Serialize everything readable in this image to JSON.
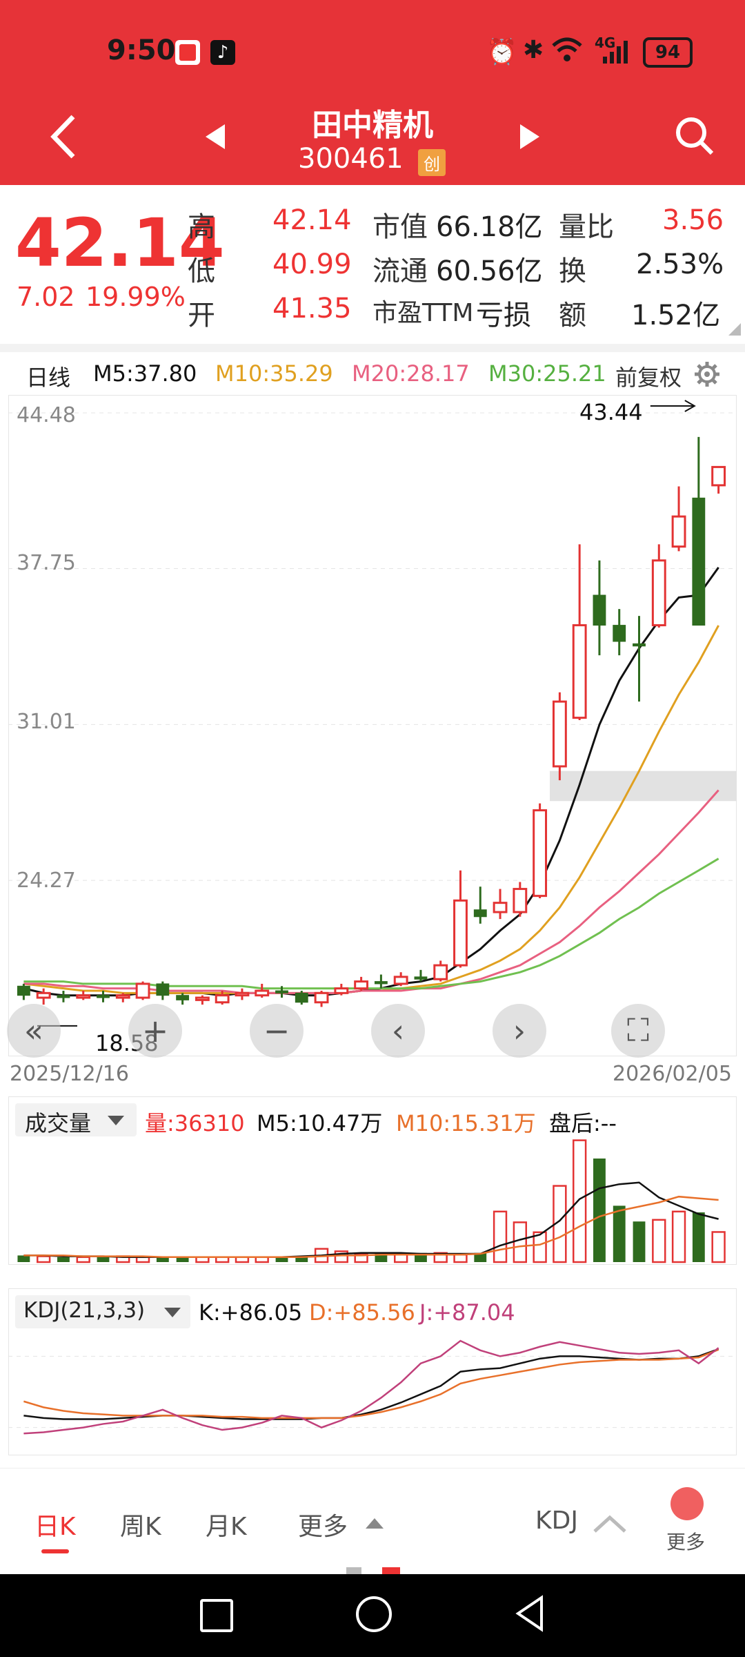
{
  "status_bar": {
    "time": "9:50",
    "battery": "94",
    "network": "4G"
  },
  "header": {
    "title": "田中精机",
    "code": "300461",
    "board_badge": "创"
  },
  "quote": {
    "price": "42.14",
    "change": "7.02",
    "change_pct": "19.99%",
    "rows": [
      {
        "l1": "高",
        "v1": "42.14",
        "l2": "市值",
        "v2": "66.18亿",
        "l3": "量比",
        "v3": "3.56"
      },
      {
        "l1": "低",
        "v1": "40.99",
        "l2": "流通",
        "v2": "60.56亿",
        "l3": "换",
        "v3": "2.53%"
      },
      {
        "l1": "开",
        "v1": "41.35",
        "l2": "市盈TTM",
        "v2": "亏损",
        "l3": "额",
        "v3": "1.52亿"
      }
    ]
  },
  "ma_bar": {
    "period": "日线",
    "m5": "M5:37.80",
    "m10": "M10:35.29",
    "m20": "M20:28.17",
    "m30": "M30:25.21",
    "adjust": "前复权"
  },
  "price_axis": [
    "44.48",
    "37.75",
    "31.01",
    "24.27"
  ],
  "price_annotations": {
    "high": "43.44",
    "low": "18.58"
  },
  "dates": {
    "start": "2025/12/16",
    "end": "2026/02/05"
  },
  "volume_bar": {
    "selector": "成交量",
    "vol": "量:36310",
    "m5": "M5:10.47万",
    "m10": "M10:15.31万",
    "after_hours": "盘后:--"
  },
  "kdj_bar": {
    "selector": "KDJ(21,3,3)",
    "k": "K:+86.05",
    "d": "D:+85.56",
    "j": "J:+87.04"
  },
  "bottom_tabs": {
    "daily": "日K",
    "weekly": "周K",
    "monthly": "月K",
    "more": "更多",
    "indicator": "KDJ",
    "more2": "更多"
  },
  "colors": {
    "header": "#e63338",
    "up": "#e33333",
    "down": "#2e6b1e",
    "m5": "#111111",
    "m10": "#e0a020",
    "m20": "#e86080",
    "m30": "#70c050"
  },
  "chart_data": {
    "type": "candlestick",
    "y_axis_ticks": [
      44.48,
      37.75,
      31.01,
      24.27
    ],
    "ylim": [
      17.5,
      44.48
    ],
    "x_range": [
      "2025/12/16",
      "2026/02/05"
    ],
    "candles": [
      {
        "o": 19.7,
        "c": 19.3,
        "h": 19.8,
        "l": 19.1
      },
      {
        "o": 19.2,
        "c": 19.4,
        "h": 19.6,
        "l": 18.9
      },
      {
        "o": 19.3,
        "c": 19.2,
        "h": 19.5,
        "l": 19.0
      },
      {
        "o": 19.2,
        "c": 19.3,
        "h": 19.5,
        "l": 19.1
      },
      {
        "o": 19.3,
        "c": 19.2,
        "h": 19.5,
        "l": 19.0
      },
      {
        "o": 19.2,
        "c": 19.3,
        "h": 19.4,
        "l": 19.0
      },
      {
        "o": 19.2,
        "c": 19.8,
        "h": 19.9,
        "l": 19.1
      },
      {
        "o": 19.8,
        "c": 19.3,
        "h": 19.9,
        "l": 19.1
      },
      {
        "o": 19.3,
        "c": 19.1,
        "h": 19.4,
        "l": 18.9
      },
      {
        "o": 19.1,
        "c": 19.2,
        "h": 19.3,
        "l": 18.9
      },
      {
        "o": 19.0,
        "c": 19.3,
        "h": 19.5,
        "l": 18.9
      },
      {
        "o": 19.3,
        "c": 19.4,
        "h": 19.6,
        "l": 19.1
      },
      {
        "o": 19.3,
        "c": 19.5,
        "h": 19.8,
        "l": 19.2
      },
      {
        "o": 19.5,
        "c": 19.4,
        "h": 19.7,
        "l": 19.2
      },
      {
        "o": 19.4,
        "c": 19.0,
        "h": 19.5,
        "l": 18.9
      },
      {
        "o": 19.0,
        "c": 19.4,
        "h": 19.5,
        "l": 18.8
      },
      {
        "o": 19.4,
        "c": 19.6,
        "h": 19.8,
        "l": 19.3
      },
      {
        "o": 19.6,
        "c": 19.9,
        "h": 20.1,
        "l": 19.5
      },
      {
        "o": 19.9,
        "c": 19.8,
        "h": 20.2,
        "l": 19.6
      },
      {
        "o": 19.8,
        "c": 20.1,
        "h": 20.3,
        "l": 19.7
      },
      {
        "o": 20.1,
        "c": 20.0,
        "h": 20.4,
        "l": 19.9
      },
      {
        "o": 20.0,
        "c": 20.6,
        "h": 20.8,
        "l": 19.9
      },
      {
        "o": 20.6,
        "c": 23.4,
        "h": 24.7,
        "l": 20.5
      },
      {
        "o": 23.0,
        "c": 22.7,
        "h": 24.0,
        "l": 22.4
      },
      {
        "o": 22.9,
        "c": 23.3,
        "h": 23.9,
        "l": 22.6
      },
      {
        "o": 22.9,
        "c": 23.9,
        "h": 24.2,
        "l": 22.7
      },
      {
        "o": 23.6,
        "c": 27.3,
        "h": 27.6,
        "l": 23.5
      },
      {
        "o": 29.2,
        "c": 32.0,
        "h": 32.4,
        "l": 28.6
      },
      {
        "o": 31.3,
        "c": 35.3,
        "h": 38.8,
        "l": 31.2
      },
      {
        "o": 36.6,
        "c": 35.3,
        "h": 38.1,
        "l": 34.0
      },
      {
        "o": 35.3,
        "c": 34.6,
        "h": 36.0,
        "l": 34.0
      },
      {
        "o": 34.5,
        "c": 34.4,
        "h": 35.7,
        "l": 32.0
      },
      {
        "o": 35.3,
        "c": 38.1,
        "h": 38.8,
        "l": 35.2
      },
      {
        "o": 38.7,
        "c": 40.0,
        "h": 41.3,
        "l": 38.5
      },
      {
        "o": 40.8,
        "c": 35.3,
        "h": 43.44,
        "l": 35.3
      },
      {
        "o": 41.35,
        "c": 42.14,
        "h": 42.14,
        "l": 40.99
      }
    ],
    "ma": {
      "M5": [
        19.6,
        19.4,
        19.3,
        19.3,
        19.3,
        19.3,
        19.4,
        19.4,
        19.4,
        19.4,
        19.3,
        19.4,
        19.4,
        19.4,
        19.3,
        19.3,
        19.4,
        19.5,
        19.6,
        19.8,
        19.9,
        20.1,
        20.7,
        21.3,
        22.1,
        22.8,
        24.1,
        26.0,
        28.4,
        31.0,
        32.9,
        34.3,
        35.5,
        36.5,
        36.6,
        37.8
      ],
      "M10": [
        19.8,
        19.7,
        19.6,
        19.5,
        19.5,
        19.4,
        19.4,
        19.4,
        19.4,
        19.4,
        19.4,
        19.4,
        19.4,
        19.4,
        19.4,
        19.4,
        19.4,
        19.5,
        19.5,
        19.6,
        19.7,
        19.8,
        20.1,
        20.4,
        20.8,
        21.3,
        22.1,
        23.1,
        24.4,
        25.9,
        27.4,
        29.0,
        30.7,
        32.3,
        33.7,
        35.29
      ],
      "M20": [
        19.8,
        19.8,
        19.7,
        19.7,
        19.6,
        19.6,
        19.6,
        19.5,
        19.5,
        19.5,
        19.5,
        19.4,
        19.4,
        19.4,
        19.4,
        19.4,
        19.4,
        19.5,
        19.5,
        19.5,
        19.6,
        19.6,
        19.8,
        20.0,
        20.3,
        20.6,
        21.1,
        21.6,
        22.3,
        23.1,
        23.8,
        24.6,
        25.4,
        26.3,
        27.2,
        28.17
      ],
      "M30": [
        19.9,
        19.9,
        19.9,
        19.8,
        19.8,
        19.8,
        19.8,
        19.7,
        19.7,
        19.7,
        19.7,
        19.7,
        19.6,
        19.6,
        19.6,
        19.6,
        19.6,
        19.6,
        19.6,
        19.6,
        19.6,
        19.7,
        19.8,
        19.9,
        20.1,
        20.3,
        20.6,
        21.0,
        21.5,
        22.0,
        22.6,
        23.1,
        23.7,
        24.2,
        24.7,
        25.21
      ]
    },
    "volume": {
      "ylim": [
        0,
        150000
      ],
      "values": [
        8000,
        7000,
        6000,
        6000,
        6000,
        7000,
        6000,
        6000,
        6000,
        6000,
        6000,
        6000,
        6000,
        6000,
        6000,
        16000,
        13000,
        10000,
        11000,
        10000,
        11000,
        11000,
        9000,
        11000,
        61000,
        48000,
        36000,
        92000,
        147000,
        125000,
        68000,
        49000,
        51000,
        61000,
        60000,
        36310
      ],
      "m5": [
        8000,
        8000,
        7000,
        7000,
        7000,
        6000,
        6000,
        6000,
        6000,
        6000,
        6000,
        6000,
        6000,
        6000,
        7000,
        8000,
        10000,
        11000,
        11000,
        11000,
        10000,
        10000,
        10000,
        10000,
        20000,
        27000,
        33000,
        50000,
        76000,
        89000,
        94000,
        96000,
        78000,
        68000,
        58000,
        52000
      ],
      "m10": [
        8000,
        8000,
        8000,
        7000,
        7000,
        7000,
        7000,
        6000,
        6000,
        6000,
        6000,
        6000,
        6000,
        6000,
        6000,
        7000,
        8000,
        8000,
        9000,
        9000,
        9000,
        9000,
        9000,
        10000,
        15000,
        19000,
        21000,
        30000,
        43000,
        55000,
        62000,
        67000,
        72000,
        79000,
        77000,
        75000
      ]
    },
    "kdj": {
      "ylim": [
        0,
        100
      ],
      "K": [
        30,
        28,
        27,
        27,
        27,
        28,
        29,
        30,
        30,
        29,
        28,
        27,
        27,
        27,
        27,
        28,
        28,
        31,
        35,
        41,
        48,
        55,
        67,
        69,
        70,
        74,
        78,
        80,
        80,
        79,
        78,
        77,
        78,
        78,
        80,
        86.05
      ],
      "D": [
        42,
        37,
        34,
        32,
        31,
        30,
        30,
        30,
        30,
        30,
        29,
        29,
        28,
        28,
        28,
        28,
        28,
        30,
        33,
        37,
        42,
        48,
        57,
        61,
        64,
        67,
        70,
        73,
        75,
        76,
        77,
        77,
        77,
        78,
        79,
        85.56
      ],
      "J": [
        15,
        16,
        18,
        20,
        23,
        25,
        30,
        35,
        28,
        22,
        18,
        20,
        24,
        30,
        28,
        20,
        26,
        34,
        45,
        58,
        74,
        80,
        93,
        85,
        80,
        83,
        88,
        92,
        89,
        86,
        83,
        82,
        83,
        85,
        74,
        87.04
      ]
    }
  }
}
